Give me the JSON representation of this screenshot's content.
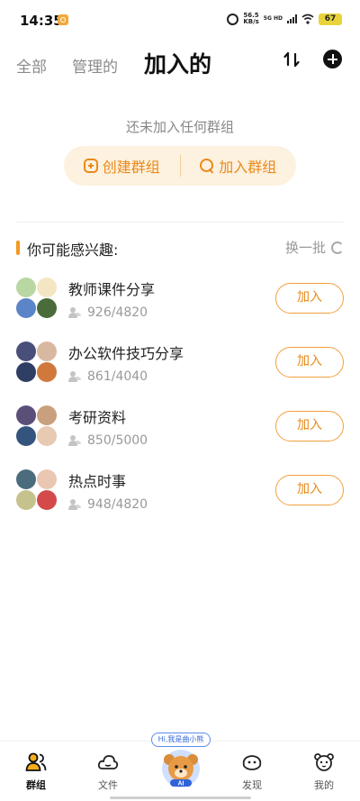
{
  "status_bar": {
    "time": "14:35",
    "speed_value": "56.5",
    "speed_unit": "KB/s",
    "network": "5G HD",
    "battery": "67"
  },
  "tabs": [
    {
      "label": "全部",
      "active": false
    },
    {
      "label": "管理的",
      "active": false
    },
    {
      "label": "加入的",
      "active": true
    }
  ],
  "empty_state": {
    "message": "还未加入任何群组",
    "create_label": "创建群组",
    "join_label": "加入群组"
  },
  "recommend": {
    "title": "你可能感兴趣:",
    "refresh_label": "换一批",
    "join_label": "加入",
    "groups": [
      {
        "name": "教师课件分享",
        "members": "926/4820",
        "avatar_colors": [
          "#b9d7a2",
          "#f4e6c2",
          "#5c84c9",
          "#4a6b3a"
        ]
      },
      {
        "name": "办公软件技巧分享",
        "members": "861/4040",
        "avatar_colors": [
          "#4a4e7a",
          "#d9b8a2",
          "#2f3f63",
          "#cf7a3c"
        ]
      },
      {
        "name": "考研资料",
        "members": "850/5000",
        "avatar_colors": [
          "#5a4f78",
          "#c9a07d",
          "#35547d",
          "#e8c9b2"
        ]
      },
      {
        "name": "热点时事",
        "members": "948/4820",
        "avatar_colors": [
          "#4b6c7c",
          "#e9c7b3",
          "#c6c28d",
          "#d44a4a"
        ]
      }
    ]
  },
  "bottom_nav": {
    "items": [
      "群组",
      "文件",
      "AI",
      "发现",
      "我的"
    ],
    "ai_greeting": "Hi,我是曲小熊"
  },
  "colors": {
    "accent": "#e98a1a",
    "pill_bg": "#fdf1df"
  }
}
